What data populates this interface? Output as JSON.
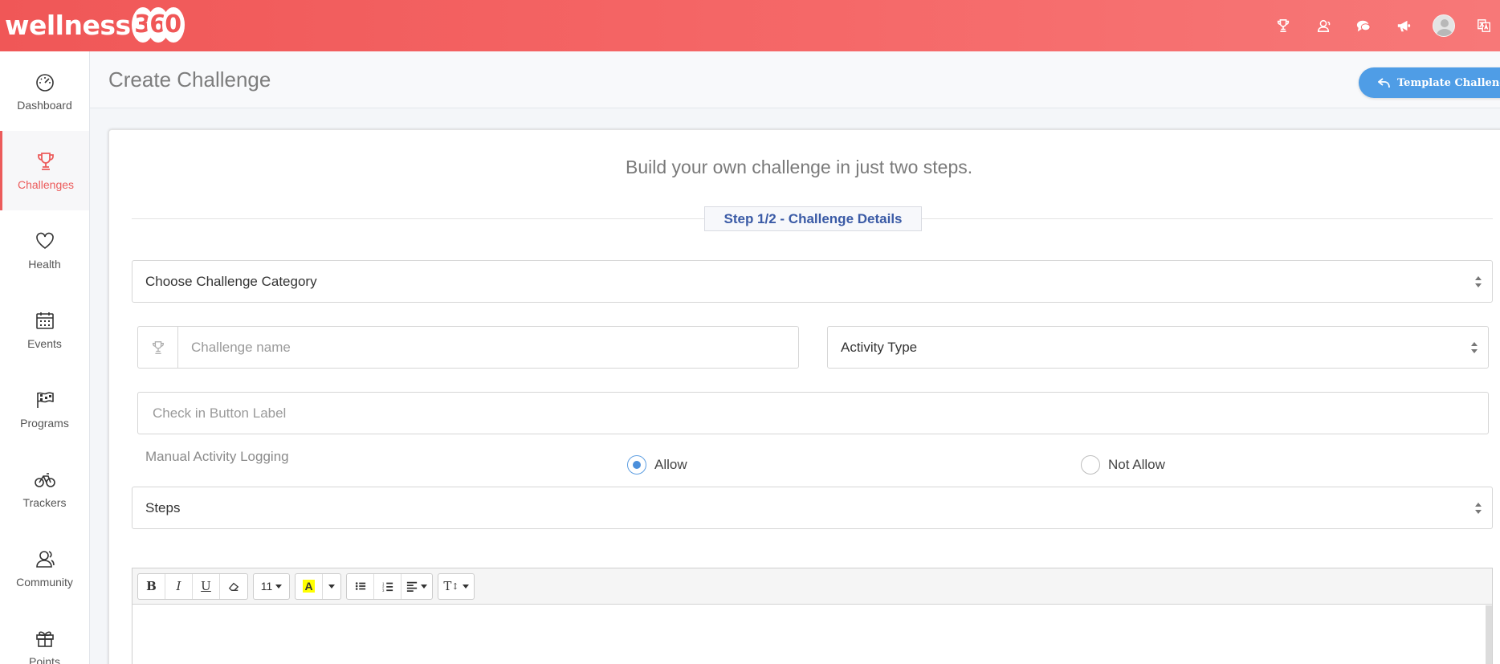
{
  "app": {
    "logo_text": "wellness",
    "logo_digits": [
      "3",
      "6",
      "0"
    ]
  },
  "header_icons": [
    "trophy-icon",
    "users-icon",
    "chat-icon",
    "megaphone-icon",
    "avatar",
    "translate-icon"
  ],
  "sidebar": {
    "items": [
      {
        "label": "Dashboard",
        "icon": "speedometer-icon"
      },
      {
        "label": "Challenges",
        "icon": "trophy-icon",
        "active": true
      },
      {
        "label": "Health",
        "icon": "heart-icon"
      },
      {
        "label": "Events",
        "icon": "calendar-icon"
      },
      {
        "label": "Programs",
        "icon": "flags-icon"
      },
      {
        "label": "Trackers",
        "icon": "bicycle-icon"
      },
      {
        "label": "Community",
        "icon": "community-icon"
      },
      {
        "label": "Points",
        "icon": "gift-icon"
      }
    ]
  },
  "page": {
    "title": "Create Challenge",
    "template_button": "Template Challenge"
  },
  "form": {
    "subtitle": "Build your own challenge in just two steps.",
    "step_label": "Step 1/2 - Challenge Details",
    "category_select": "Choose Challenge Category",
    "challenge_name_placeholder": "Challenge name",
    "activity_type_select": "Activity Type",
    "checkin_placeholder": "Check in Button Label",
    "manual_logging_label": "Manual Activity Logging",
    "radio_allow": "Allow",
    "radio_not_allow": "Not Allow",
    "selected_radio": "Allow",
    "unit_select": "Steps"
  },
  "editor": {
    "font_size": "11",
    "color_letter": "A",
    "font_family_glyph": "T"
  },
  "colors": {
    "brand": "#f05757",
    "active_nav": "#ec5b5b",
    "button_blue": "#4f9de6",
    "step_text": "#3b5ba6"
  }
}
